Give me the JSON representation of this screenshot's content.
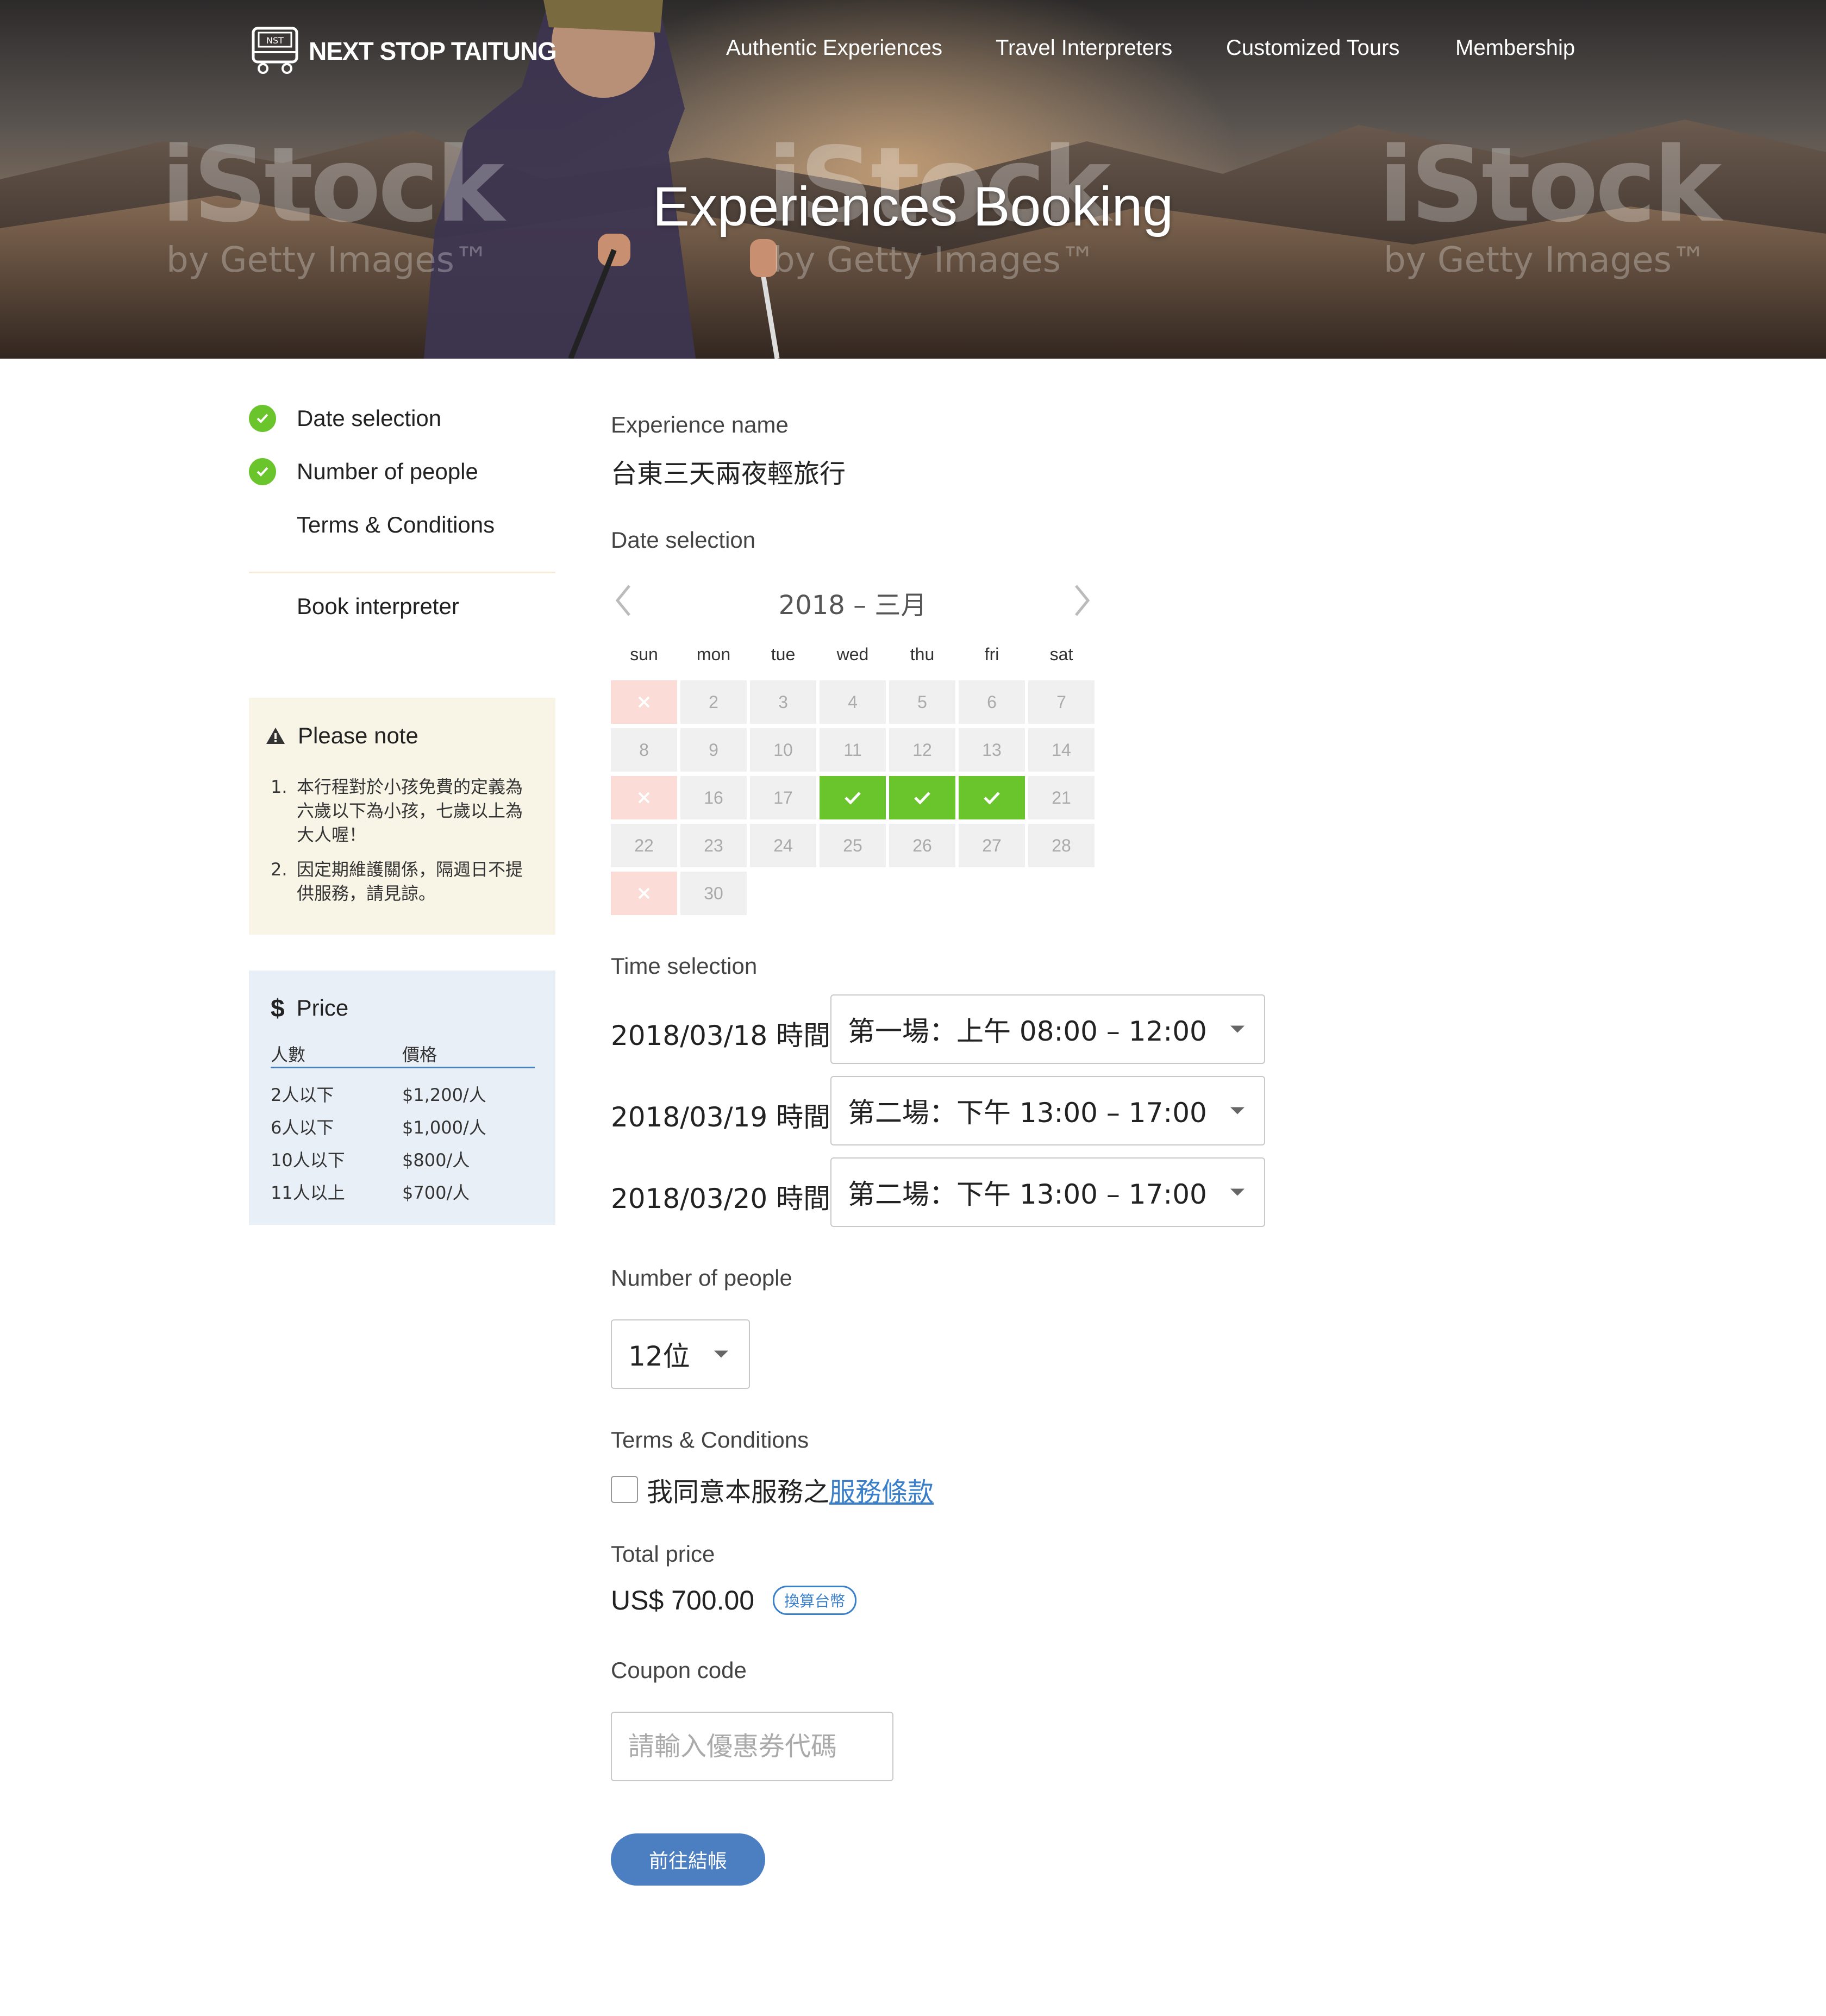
{
  "header": {
    "logo_text": "NEXT STOP TAITUNG",
    "logo_badge": "NST",
    "nav": [
      "Authentic Experiences",
      "Travel Interpreters",
      "Customized Tours",
      "Membership"
    ],
    "hero_title": "Experiences Booking",
    "watermark_main": "iStock",
    "watermark_sub": "by Getty Images™"
  },
  "steps": [
    {
      "label": "Date selection",
      "done": true
    },
    {
      "label": "Number of people",
      "done": true
    },
    {
      "label": "Terms & Conditions",
      "done": false
    },
    {
      "label": "Book interpreter",
      "done": false
    }
  ],
  "note": {
    "title": "Please note",
    "items": [
      {
        "num": "1.",
        "text": "本行程對於小孩免費的定義為六歲以下為小孩，七歲以上為大人喔！"
      },
      {
        "num": "2.",
        "text": "因定期維護關係，隔週日不提供服務，請見諒。"
      }
    ]
  },
  "price": {
    "title": "Price",
    "symbol": "$",
    "headers": [
      "人數",
      "價格"
    ],
    "rows": [
      [
        "2人以下",
        "$1,200/人"
      ],
      [
        "6人以下",
        "$1,000/人"
      ],
      [
        "10人以下",
        "$800/人"
      ],
      [
        "11人以上",
        "$700/人"
      ]
    ]
  },
  "main": {
    "experience_name_label": "Experience name",
    "experience_name": "台東三天兩夜輕旅行",
    "date_label": "Date selection",
    "calendar": {
      "title": "2018 – 三月",
      "weekdays": [
        "sun",
        "mon",
        "tue",
        "wed",
        "thu",
        "fri",
        "sat"
      ],
      "rows": [
        [
          {
            "t": "×",
            "s": "closed"
          },
          {
            "t": "2"
          },
          {
            "t": "3"
          },
          {
            "t": "4"
          },
          {
            "t": "5"
          },
          {
            "t": "6"
          },
          {
            "t": "7"
          }
        ],
        [
          {
            "t": "8"
          },
          {
            "t": "9"
          },
          {
            "t": "10"
          },
          {
            "t": "11"
          },
          {
            "t": "12"
          },
          {
            "t": "13"
          },
          {
            "t": "14"
          }
        ],
        [
          {
            "t": "×",
            "s": "closed"
          },
          {
            "t": "16"
          },
          {
            "t": "17"
          },
          {
            "t": "✓",
            "s": "selected"
          },
          {
            "t": "✓",
            "s": "selected"
          },
          {
            "t": "✓",
            "s": "selected"
          },
          {
            "t": "21"
          }
        ],
        [
          {
            "t": "22"
          },
          {
            "t": "23"
          },
          {
            "t": "24"
          },
          {
            "t": "25"
          },
          {
            "t": "26"
          },
          {
            "t": "27"
          },
          {
            "t": "28"
          }
        ],
        [
          {
            "t": "×",
            "s": "closed"
          },
          {
            "t": "30"
          }
        ]
      ]
    },
    "time_label": "Time selection",
    "times": [
      {
        "date": "2018/03/18 時間",
        "value": "第一場：上午 08:00 – 12:00"
      },
      {
        "date": "2018/03/19 時間",
        "value": "第二場：下午 13:00 – 17:00"
      },
      {
        "date": "2018/03/20 時間",
        "value": "第二場：下午 13:00 – 17:00"
      }
    ],
    "people_label": "Number of people",
    "people_value": "12位",
    "terms_label": "Terms & Conditions",
    "terms_text": "我同意本服務之",
    "terms_link": "服務條款",
    "total_label": "Total price",
    "total_value": "US$ 700.00",
    "convert_label": "換算台幣",
    "coupon_label": "Coupon code",
    "coupon_placeholder": "請輸入優惠券代碼",
    "checkout_label": "前往結帳"
  },
  "colors": {
    "accent_green": "#6ac42b",
    "accent_blue": "#4b7fc2",
    "closed_pink": "#fbdcd7",
    "note_bg": "#f8f5e7",
    "price_bg": "#e9eff7"
  }
}
